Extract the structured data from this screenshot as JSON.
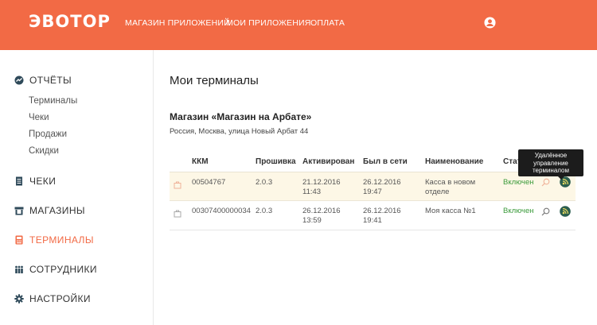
{
  "header": {
    "logo": "ЭВОТОР",
    "nav": [
      "МАГАЗИН ПРИЛОЖЕНИЙ",
      "МОИ ПРИЛОЖЕНИЯ",
      "ОПЛАТА"
    ],
    "user_icon": "user-icon"
  },
  "sidebar": {
    "reports": {
      "label": "ОТЧЁТЫ",
      "icon": "chart-icon"
    },
    "sub_items": [
      "Терминалы",
      "Чеки",
      "Продажи",
      "Скидки"
    ],
    "items": [
      {
        "label": "ЧЕКИ",
        "icon": "receipt-icon"
      },
      {
        "label": "МАГАЗИНЫ",
        "icon": "store-icon"
      },
      {
        "label": "ТЕРМИНАЛЫ",
        "icon": "terminal-icon",
        "active": true
      },
      {
        "label": "СОТРУДНИКИ",
        "icon": "people-icon"
      },
      {
        "label": "НАСТРОЙКИ",
        "icon": "gear-icon"
      }
    ]
  },
  "main": {
    "title": "Мои терминалы",
    "store_name": "Магазин «Магазин на Арбате»",
    "store_address": "Россия, Москва, улица Новый Арбат 44",
    "columns": [
      "ККМ",
      "Прошивка",
      "Активирован",
      "Был в сети",
      "Наименование",
      "Стат"
    ],
    "rows": [
      {
        "kkm": "00504767",
        "firmware": "2.0.3",
        "activated_date": "21.12.2016",
        "activated_time": "11:43",
        "online_date": "26.12.2016",
        "online_time": "19:47",
        "name_line1": "Касса в новом",
        "name_line2": "отделе",
        "status": "Включен"
      },
      {
        "kkm": "00307400000034",
        "firmware": "2.0.3",
        "activated_date": "26.12.2016",
        "activated_time": "13:59",
        "online_date": "26.12.2016",
        "online_time": "19:41",
        "name_line1": "Моя касса №1",
        "name_line2": "",
        "status": "Включен"
      }
    ],
    "tooltip": [
      "Удалённое",
      "управление",
      "терминалом"
    ]
  },
  "colors": {
    "accent": "#f26a45",
    "status_on": "#3a9a3a",
    "highlight_row": "#fdf7e6"
  }
}
